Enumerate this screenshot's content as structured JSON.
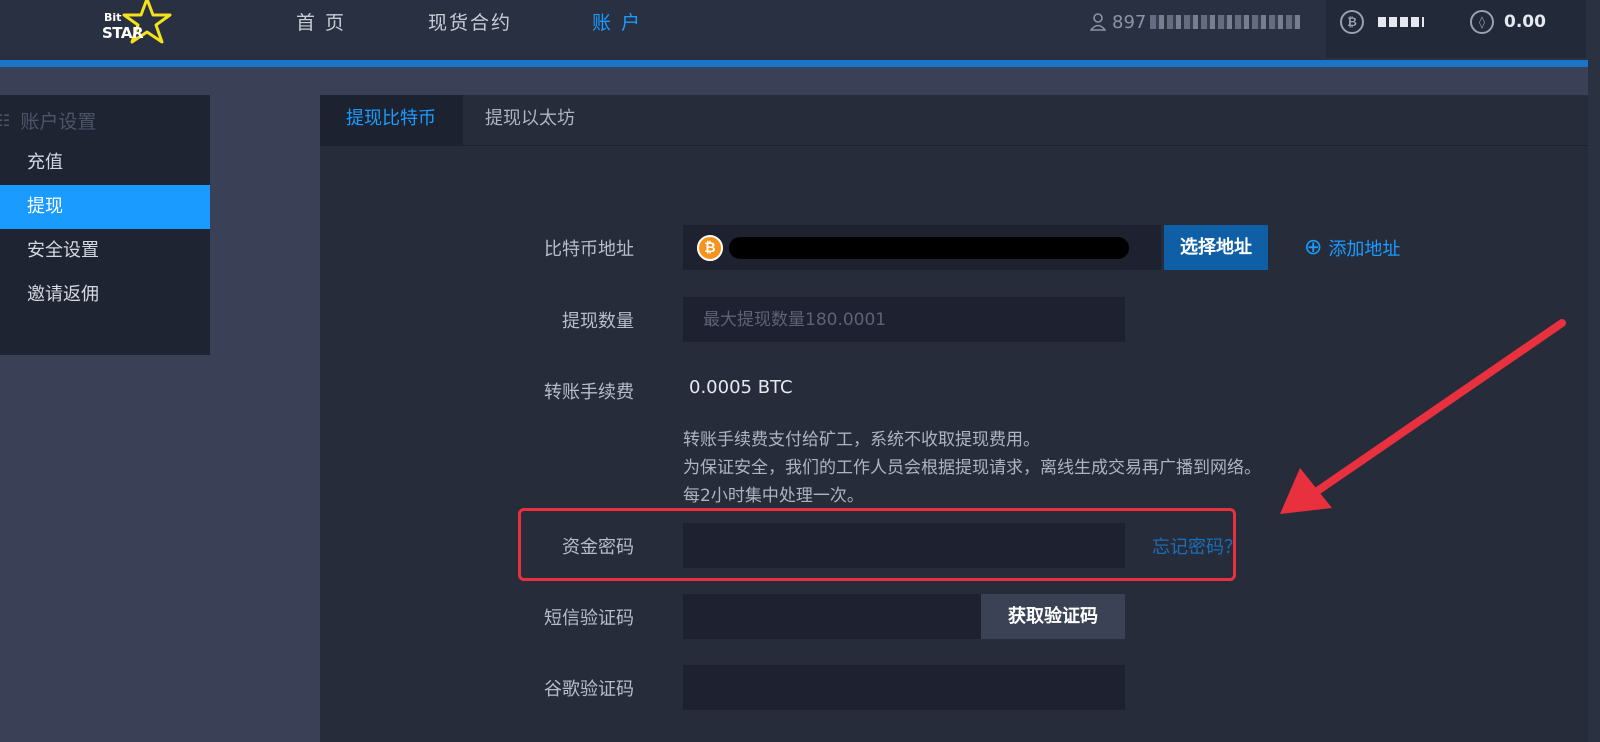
{
  "header": {
    "logo_small": "Bit",
    "logo_large": "STAR",
    "nav": [
      {
        "label": "首 页"
      },
      {
        "label": "现货合约"
      },
      {
        "label": "账 户"
      }
    ],
    "user_id": "897",
    "balances": {
      "btc_symbol": "₿",
      "eth_symbol": "◊",
      "eth_value": "0.00"
    }
  },
  "sidebar": {
    "heading": "账户设置",
    "heading_icon": "☷",
    "items": [
      {
        "label": "充值"
      },
      {
        "label": "提现"
      },
      {
        "label": "安全设置"
      },
      {
        "label": "邀请返佣"
      }
    ]
  },
  "tabs": [
    {
      "label": "提现比特币"
    },
    {
      "label": "提现以太坊"
    }
  ],
  "form": {
    "address_label": "比特币地址",
    "btc_icon_symbol": "₿",
    "select_address": "选择地址",
    "add_address_icon": "⊕",
    "add_address": "添加地址",
    "amount_label": "提现数量",
    "amount_placeholder": "最大提现数量180.0001",
    "fee_label": "转账手续费",
    "fee_value": "0.0005 BTC",
    "notes": [
      "转账手续费支付给矿工，系统不收取提现费用。",
      "为保证安全，我们的工作人员会根据提现请求，离线生成交易再广播到网络。",
      "每2小时集中处理一次。"
    ],
    "fund_password_label": "资金密码",
    "forgot_password": "忘记密码？",
    "sms_label": "短信验证码",
    "get_code": "获取验证码",
    "google_label": "谷歌验证码"
  },
  "colors": {
    "accent": "#1a9bff",
    "highlight_red": "#e8303e",
    "bitcoin_orange": "#f7931a"
  }
}
